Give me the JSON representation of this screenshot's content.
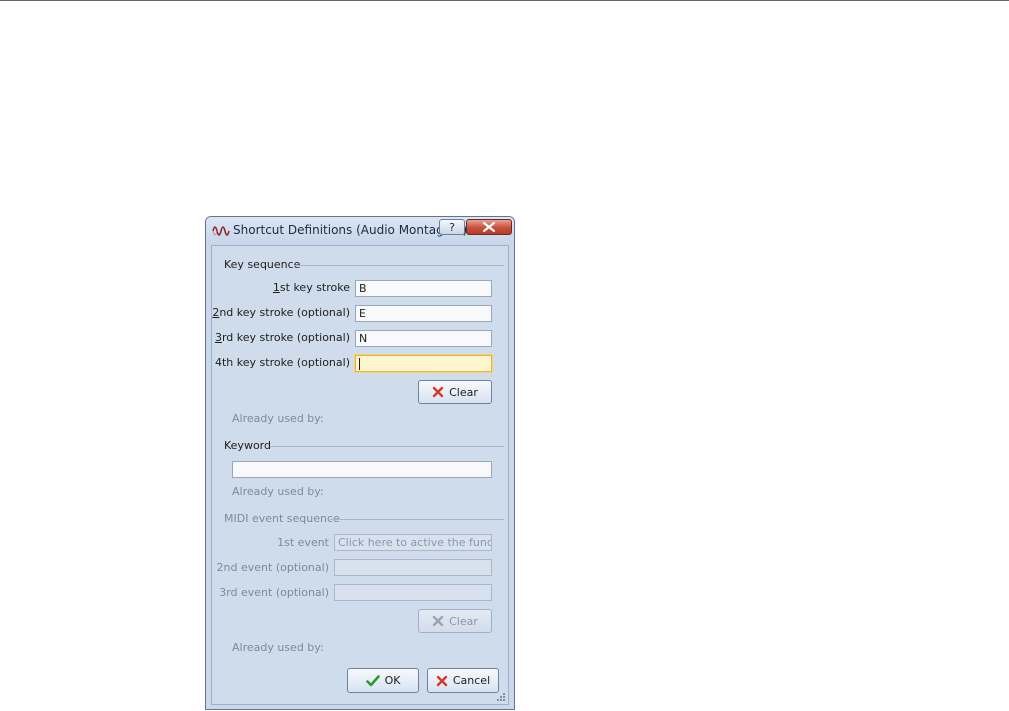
{
  "dialog": {
    "title": "Shortcut Definitions (Audio Montage...)",
    "help_glyph": "?",
    "key_sequence": {
      "title": "Key sequence",
      "strokes": [
        {
          "label_accel": "1",
          "label_rest": "st key stroke",
          "value": "B"
        },
        {
          "label_accel": "2",
          "label_rest": "nd key stroke (optional)",
          "value": "E"
        },
        {
          "label_accel": "3",
          "label_rest": "rd key stroke (optional)",
          "value": "N"
        },
        {
          "label_accel": "",
          "label_rest": "4th key stroke (optional)",
          "value": ""
        }
      ],
      "clear_label": "Clear",
      "already_used": "Already used by:"
    },
    "keyword": {
      "title": "Keyword",
      "value": "",
      "already_used": "Already used by:"
    },
    "midi": {
      "title": "MIDI event sequence",
      "events": [
        {
          "label": "1st event",
          "value": "Click here to active the functio..."
        },
        {
          "label": "2nd event (optional)",
          "value": ""
        },
        {
          "label": "3rd event (optional)",
          "value": ""
        }
      ],
      "clear_label": "Clear",
      "already_used": "Already used by:"
    },
    "ok_label": "OK",
    "cancel_label": "Cancel"
  },
  "colors": {
    "accent_focus": "#e8b33a",
    "close_red": "#c8503d",
    "clear_red": "#d23a2a",
    "ok_green": "#2f9a2a"
  },
  "icons": {
    "app": "waveform-icon",
    "help": "help-icon",
    "close": "close-icon",
    "clear": "red-x-icon",
    "ok": "checkmark-icon",
    "resize": "resize-grip-icon"
  }
}
